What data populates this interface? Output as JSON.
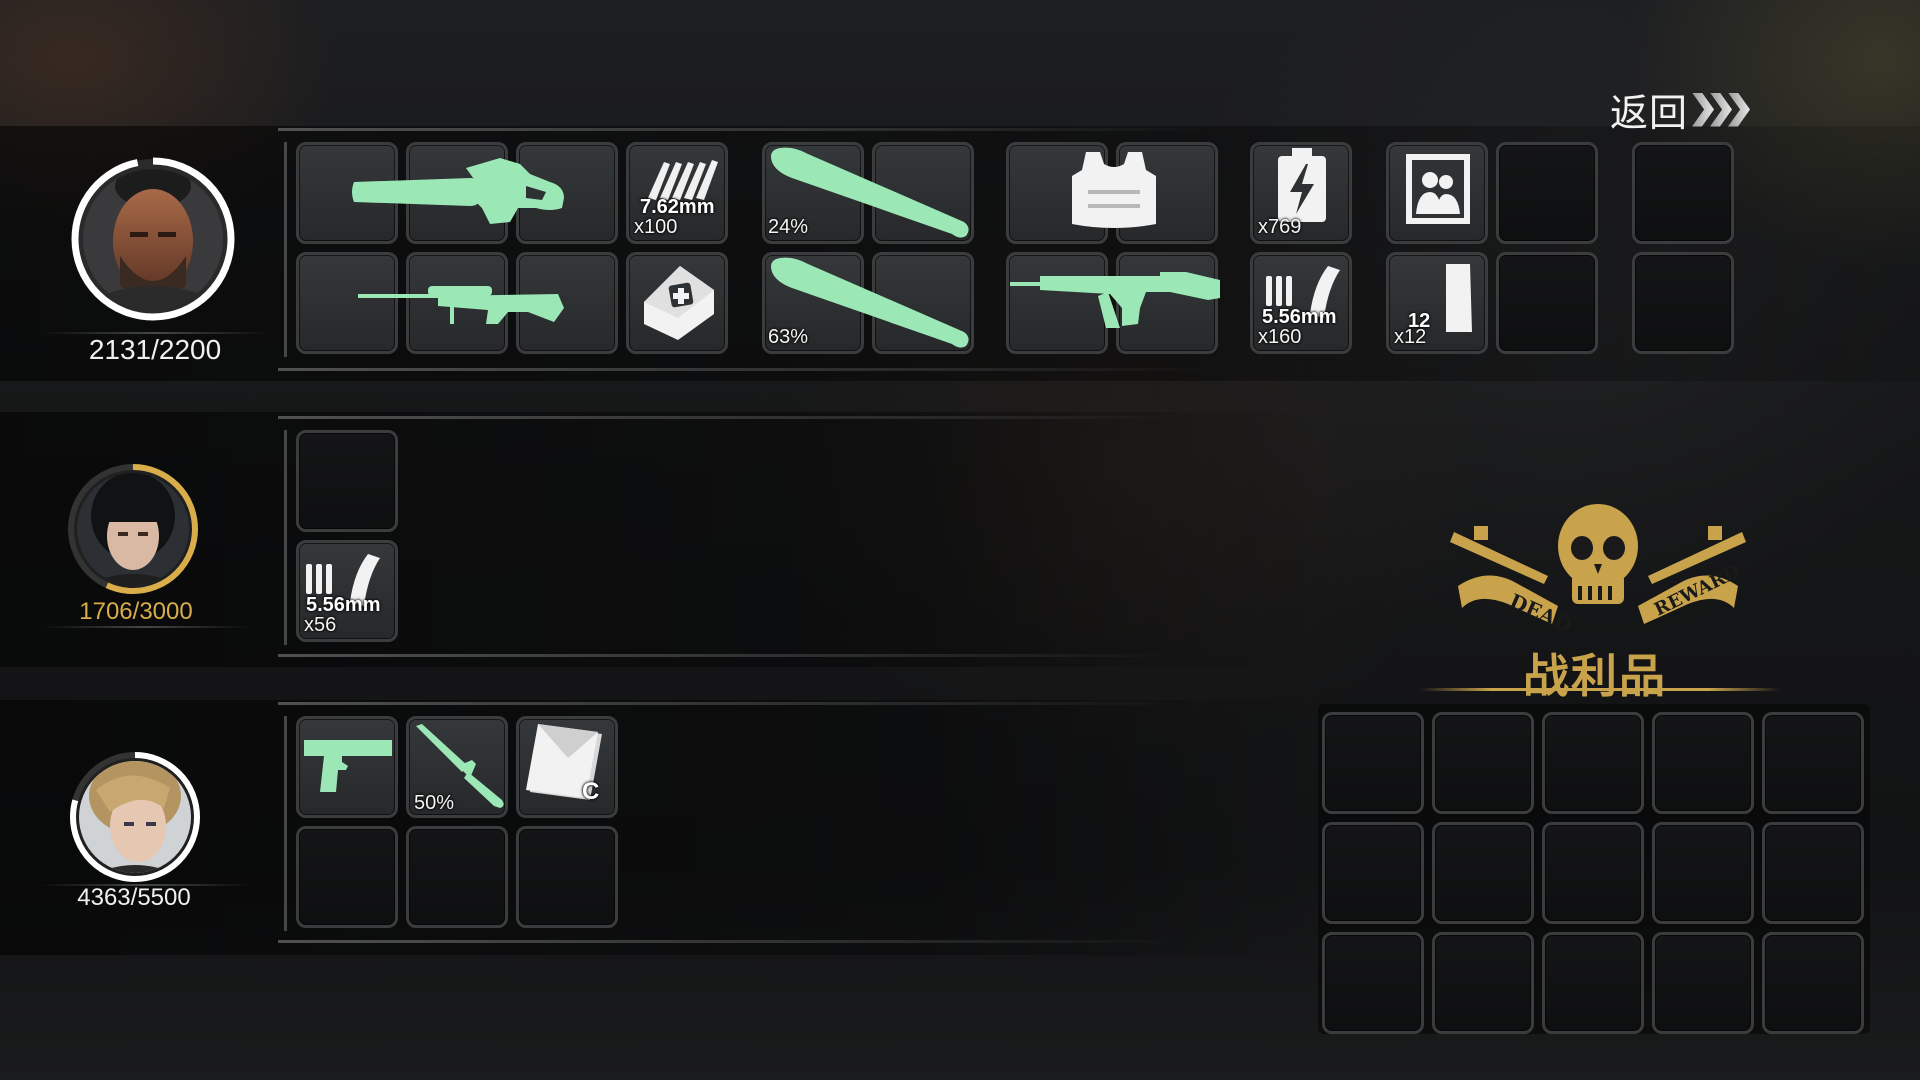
{
  "back_button": {
    "label": "返回"
  },
  "characters": [
    {
      "hp": "2131/2200",
      "hp_fraction": 0.968,
      "ring_color": "#ffffff",
      "hp_color": "#f0f0f0"
    },
    {
      "hp": "1706/3000",
      "hp_fraction": 0.569,
      "ring_color": "#d8ad4a",
      "hp_color": "#d8ad4a"
    },
    {
      "hp": "4363/5500",
      "hp_fraction": 0.793,
      "ring_color": "#ffffff",
      "hp_color": "#f0f0f0"
    }
  ],
  "inventory_row1": {
    "chainsaw": {
      "icon": "chainsaw-icon"
    },
    "sniper_rifle": {
      "icon": "sniper-rifle-icon"
    },
    "ammo_762": {
      "caliber": "7.62mm",
      "count": "x100"
    },
    "medkit": {
      "icon": "medkit-icon"
    },
    "bat_1": {
      "durability": "24%"
    },
    "bat_2": {
      "durability": "63%"
    },
    "vest": {
      "icon": "body-armor-icon"
    },
    "assault_rifle": {
      "icon": "assault-rifle-icon"
    },
    "battery": {
      "count": "x769"
    },
    "ammo_556": {
      "caliber": "5.56mm",
      "count": "x160"
    },
    "photo": {
      "icon": "photo-icon"
    },
    "magazine": {
      "capacity": "12",
      "count": "x12"
    }
  },
  "inventory_row2": {
    "ammo_556": {
      "caliber": "5.56mm",
      "count": "x56"
    }
  },
  "inventory_row3": {
    "pistol": {
      "icon": "pistol-icon"
    },
    "knife": {
      "durability": "50%"
    },
    "envelope": {
      "grade": "C"
    }
  },
  "loot": {
    "title": "战利品",
    "emblem_left": "DEAD",
    "emblem_right": "REWARD",
    "emblem_color": "#c9a34c"
  },
  "colors": {
    "item_green": "#9be7b6",
    "gold": "#c9a34c"
  }
}
